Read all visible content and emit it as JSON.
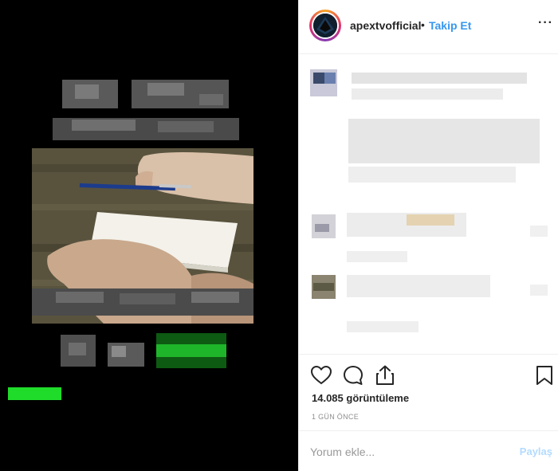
{
  "post": {
    "username": "apextvofficial",
    "separator": "•",
    "follow_label": "Takip Et",
    "more_label": "···",
    "views": "14.085 görüntüleme",
    "time_ago": "1 GÜN ÖNCE",
    "comment_placeholder": "Yorum ekle...",
    "post_label": "Paylaş",
    "video_progress": 0.18
  },
  "icons": {
    "like": "heart-icon",
    "comment": "speech-bubble-icon",
    "share": "share-icon",
    "save": "bookmark-icon",
    "more": "more-options-icon"
  },
  "colors": {
    "follow": "#3897f0",
    "post_disabled": "#b3dbff",
    "progress": "#1fdc2a"
  }
}
